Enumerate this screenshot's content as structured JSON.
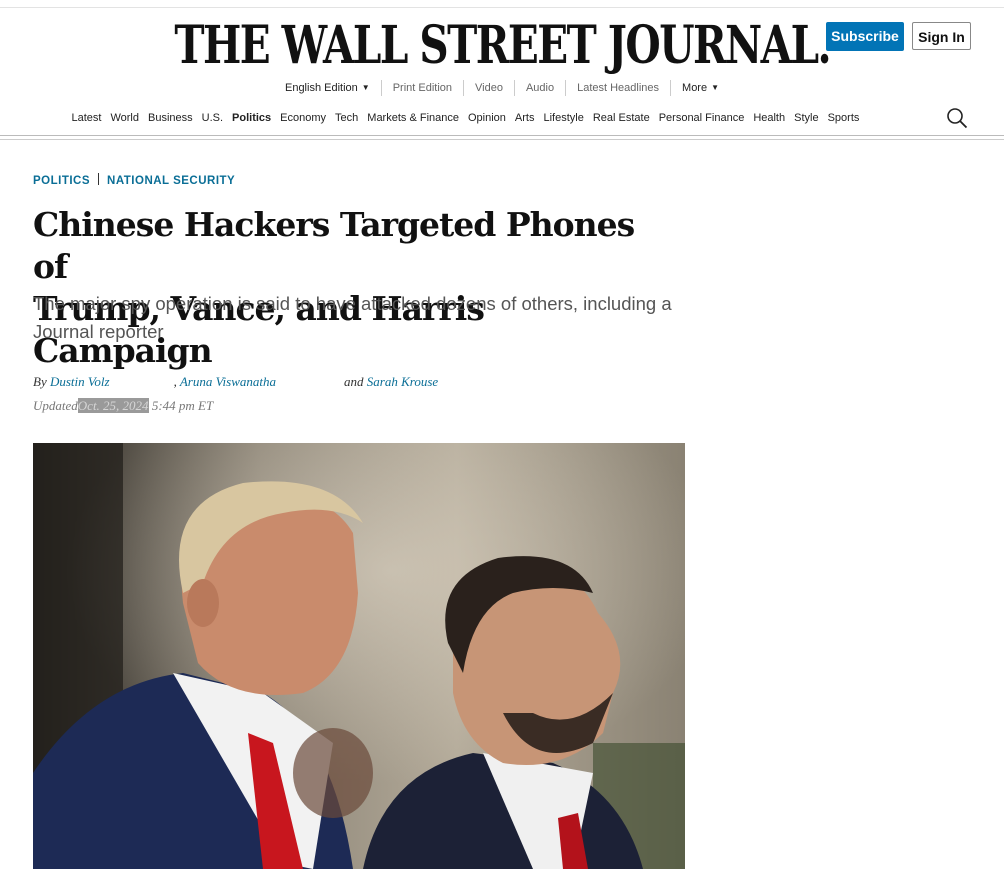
{
  "masthead": {
    "title": "THE WALL STREET JOURNAL."
  },
  "account": {
    "subscribe_label": "Subscribe",
    "signin_label": "Sign In"
  },
  "subnav": {
    "edition": "English Edition",
    "items": [
      "Print Edition",
      "Video",
      "Audio",
      "Latest Headlines"
    ],
    "more": "More"
  },
  "mainnav": {
    "items": [
      "Latest",
      "World",
      "Business",
      "U.S.",
      "Politics",
      "Economy",
      "Tech",
      "Markets & Finance",
      "Opinion",
      "Arts",
      "Lifestyle",
      "Real Estate",
      "Personal Finance",
      "Health",
      "Style",
      "Sports"
    ],
    "active": "Politics",
    "search_icon": "search-icon"
  },
  "article": {
    "category_primary": "POLITICS",
    "category_secondary": "NATIONAL SECURITY",
    "headline_line1": "Chinese Hackers Targeted Phones of",
    "headline_line2": "Trump, Vance, and Harris Campaign",
    "dek": "The major spy operation is said to have attacked dozens of others, including a Journal reporter",
    "byline": {
      "by": "By",
      "author1": "Dustin Volz",
      "comma": ",",
      "author2": "Aruna Viswanatha",
      "and": "and",
      "author3": "Sarah Krouse"
    },
    "updated_label": "Updated",
    "updated_date": "Oct. 25, 2024",
    "updated_time": "5:44 pm ET",
    "photo": "photo of Donald Trump and JD Vance"
  },
  "colors": {
    "accent": "#0274b6",
    "link": "#0a6e96"
  }
}
